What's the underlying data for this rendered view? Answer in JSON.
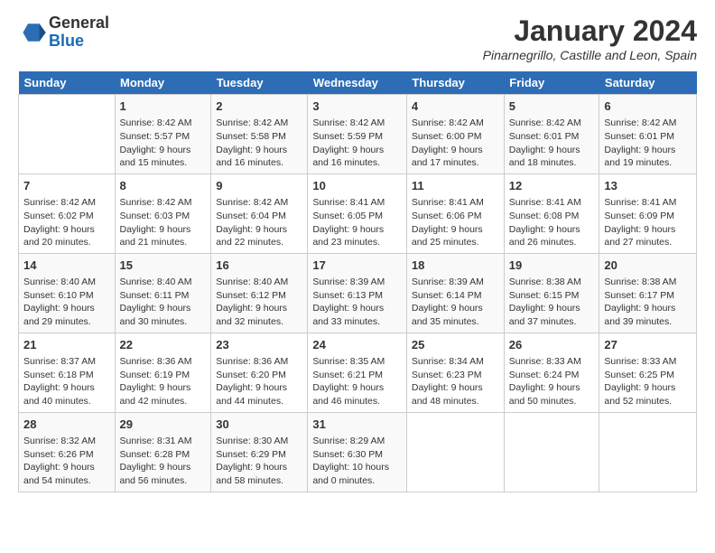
{
  "header": {
    "logo": {
      "general": "General",
      "blue": "Blue"
    },
    "title": "January 2024",
    "subtitle": "Pinarnegrillo, Castille and Leon, Spain"
  },
  "calendar": {
    "days_of_week": [
      "Sunday",
      "Monday",
      "Tuesday",
      "Wednesday",
      "Thursday",
      "Friday",
      "Saturday"
    ],
    "weeks": [
      [
        {
          "num": "",
          "info": ""
        },
        {
          "num": "1",
          "info": "Sunrise: 8:42 AM\nSunset: 5:57 PM\nDaylight: 9 hours\nand 15 minutes."
        },
        {
          "num": "2",
          "info": "Sunrise: 8:42 AM\nSunset: 5:58 PM\nDaylight: 9 hours\nand 16 minutes."
        },
        {
          "num": "3",
          "info": "Sunrise: 8:42 AM\nSunset: 5:59 PM\nDaylight: 9 hours\nand 16 minutes."
        },
        {
          "num": "4",
          "info": "Sunrise: 8:42 AM\nSunset: 6:00 PM\nDaylight: 9 hours\nand 17 minutes."
        },
        {
          "num": "5",
          "info": "Sunrise: 8:42 AM\nSunset: 6:01 PM\nDaylight: 9 hours\nand 18 minutes."
        },
        {
          "num": "6",
          "info": "Sunrise: 8:42 AM\nSunset: 6:01 PM\nDaylight: 9 hours\nand 19 minutes."
        }
      ],
      [
        {
          "num": "7",
          "info": "Sunrise: 8:42 AM\nSunset: 6:02 PM\nDaylight: 9 hours\nand 20 minutes."
        },
        {
          "num": "8",
          "info": "Sunrise: 8:42 AM\nSunset: 6:03 PM\nDaylight: 9 hours\nand 21 minutes."
        },
        {
          "num": "9",
          "info": "Sunrise: 8:42 AM\nSunset: 6:04 PM\nDaylight: 9 hours\nand 22 minutes."
        },
        {
          "num": "10",
          "info": "Sunrise: 8:41 AM\nSunset: 6:05 PM\nDaylight: 9 hours\nand 23 minutes."
        },
        {
          "num": "11",
          "info": "Sunrise: 8:41 AM\nSunset: 6:06 PM\nDaylight: 9 hours\nand 25 minutes."
        },
        {
          "num": "12",
          "info": "Sunrise: 8:41 AM\nSunset: 6:08 PM\nDaylight: 9 hours\nand 26 minutes."
        },
        {
          "num": "13",
          "info": "Sunrise: 8:41 AM\nSunset: 6:09 PM\nDaylight: 9 hours\nand 27 minutes."
        }
      ],
      [
        {
          "num": "14",
          "info": "Sunrise: 8:40 AM\nSunset: 6:10 PM\nDaylight: 9 hours\nand 29 minutes."
        },
        {
          "num": "15",
          "info": "Sunrise: 8:40 AM\nSunset: 6:11 PM\nDaylight: 9 hours\nand 30 minutes."
        },
        {
          "num": "16",
          "info": "Sunrise: 8:40 AM\nSunset: 6:12 PM\nDaylight: 9 hours\nand 32 minutes."
        },
        {
          "num": "17",
          "info": "Sunrise: 8:39 AM\nSunset: 6:13 PM\nDaylight: 9 hours\nand 33 minutes."
        },
        {
          "num": "18",
          "info": "Sunrise: 8:39 AM\nSunset: 6:14 PM\nDaylight: 9 hours\nand 35 minutes."
        },
        {
          "num": "19",
          "info": "Sunrise: 8:38 AM\nSunset: 6:15 PM\nDaylight: 9 hours\nand 37 minutes."
        },
        {
          "num": "20",
          "info": "Sunrise: 8:38 AM\nSunset: 6:17 PM\nDaylight: 9 hours\nand 39 minutes."
        }
      ],
      [
        {
          "num": "21",
          "info": "Sunrise: 8:37 AM\nSunset: 6:18 PM\nDaylight: 9 hours\nand 40 minutes."
        },
        {
          "num": "22",
          "info": "Sunrise: 8:36 AM\nSunset: 6:19 PM\nDaylight: 9 hours\nand 42 minutes."
        },
        {
          "num": "23",
          "info": "Sunrise: 8:36 AM\nSunset: 6:20 PM\nDaylight: 9 hours\nand 44 minutes."
        },
        {
          "num": "24",
          "info": "Sunrise: 8:35 AM\nSunset: 6:21 PM\nDaylight: 9 hours\nand 46 minutes."
        },
        {
          "num": "25",
          "info": "Sunrise: 8:34 AM\nSunset: 6:23 PM\nDaylight: 9 hours\nand 48 minutes."
        },
        {
          "num": "26",
          "info": "Sunrise: 8:33 AM\nSunset: 6:24 PM\nDaylight: 9 hours\nand 50 minutes."
        },
        {
          "num": "27",
          "info": "Sunrise: 8:33 AM\nSunset: 6:25 PM\nDaylight: 9 hours\nand 52 minutes."
        }
      ],
      [
        {
          "num": "28",
          "info": "Sunrise: 8:32 AM\nSunset: 6:26 PM\nDaylight: 9 hours\nand 54 minutes."
        },
        {
          "num": "29",
          "info": "Sunrise: 8:31 AM\nSunset: 6:28 PM\nDaylight: 9 hours\nand 56 minutes."
        },
        {
          "num": "30",
          "info": "Sunrise: 8:30 AM\nSunset: 6:29 PM\nDaylight: 9 hours\nand 58 minutes."
        },
        {
          "num": "31",
          "info": "Sunrise: 8:29 AM\nSunset: 6:30 PM\nDaylight: 10 hours\nand 0 minutes."
        },
        {
          "num": "",
          "info": ""
        },
        {
          "num": "",
          "info": ""
        },
        {
          "num": "",
          "info": ""
        }
      ]
    ]
  }
}
